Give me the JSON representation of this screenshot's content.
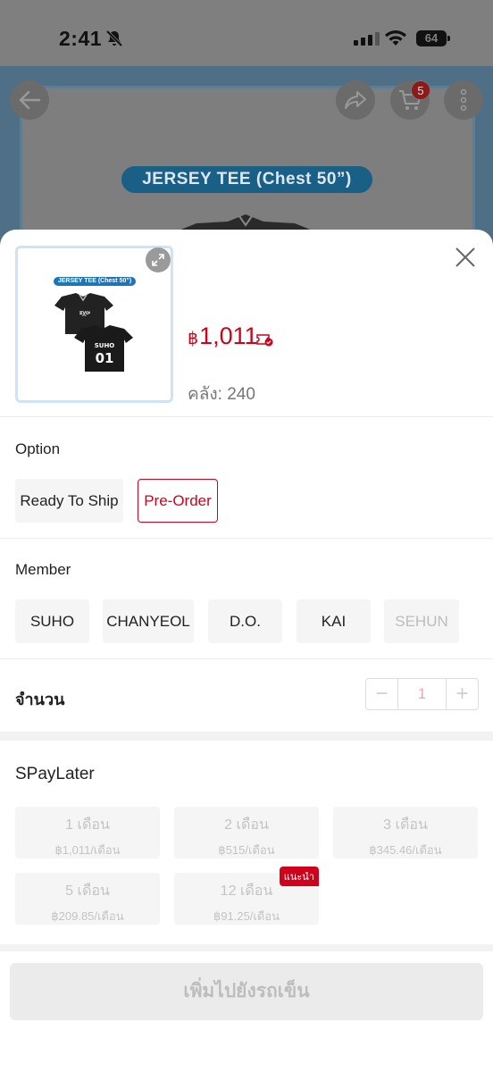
{
  "status_bar": {
    "time": "2:41",
    "battery": "64"
  },
  "background": {
    "banner_text": "JERSEY TEE (Chest 50”)",
    "cart_count": "5"
  },
  "product": {
    "thumb_banner": "JERSEY TEE (Chest 50”)",
    "thumb_member": "SUHO",
    "thumb_number": "01",
    "currency": "฿",
    "price": "1,011",
    "stock": "คลัง: 240"
  },
  "option": {
    "title": "Option",
    "items": [
      {
        "label": "Ready To Ship",
        "state": "normal"
      },
      {
        "label": "Pre-Order",
        "state": "selected"
      }
    ]
  },
  "member": {
    "title": "Member",
    "items": [
      {
        "label": "SUHO",
        "state": "normal"
      },
      {
        "label": "CHANYEOL",
        "state": "normal"
      },
      {
        "label": "D.O.",
        "state": "normal"
      },
      {
        "label": "KAI",
        "state": "normal"
      },
      {
        "label": "SEHUN",
        "state": "disabled"
      }
    ]
  },
  "quantity": {
    "title": "จำนวน",
    "value": "1",
    "minus": "−",
    "plus": "+"
  },
  "spaylater": {
    "title": "SPayLater",
    "plans": [
      {
        "months": "1 เดือน",
        "price": "฿1,011/เดือน"
      },
      {
        "months": "2 เดือน",
        "price": "฿515/เดือน"
      },
      {
        "months": "3 เดือน",
        "price": "฿345.46/เดือน"
      },
      {
        "months": "5 เดือน",
        "price": "฿209.85/เดือน"
      },
      {
        "months": "12 เดือน",
        "price": "฿91.25/เดือน",
        "tag": "แนะนำ"
      }
    ]
  },
  "add_to_cart": "เพิ่มไปยังรถเข็น",
  "colors": {
    "accent": "#d0011b",
    "selected_border": "#d0011b",
    "thumb_border": "#cfe3f7"
  }
}
